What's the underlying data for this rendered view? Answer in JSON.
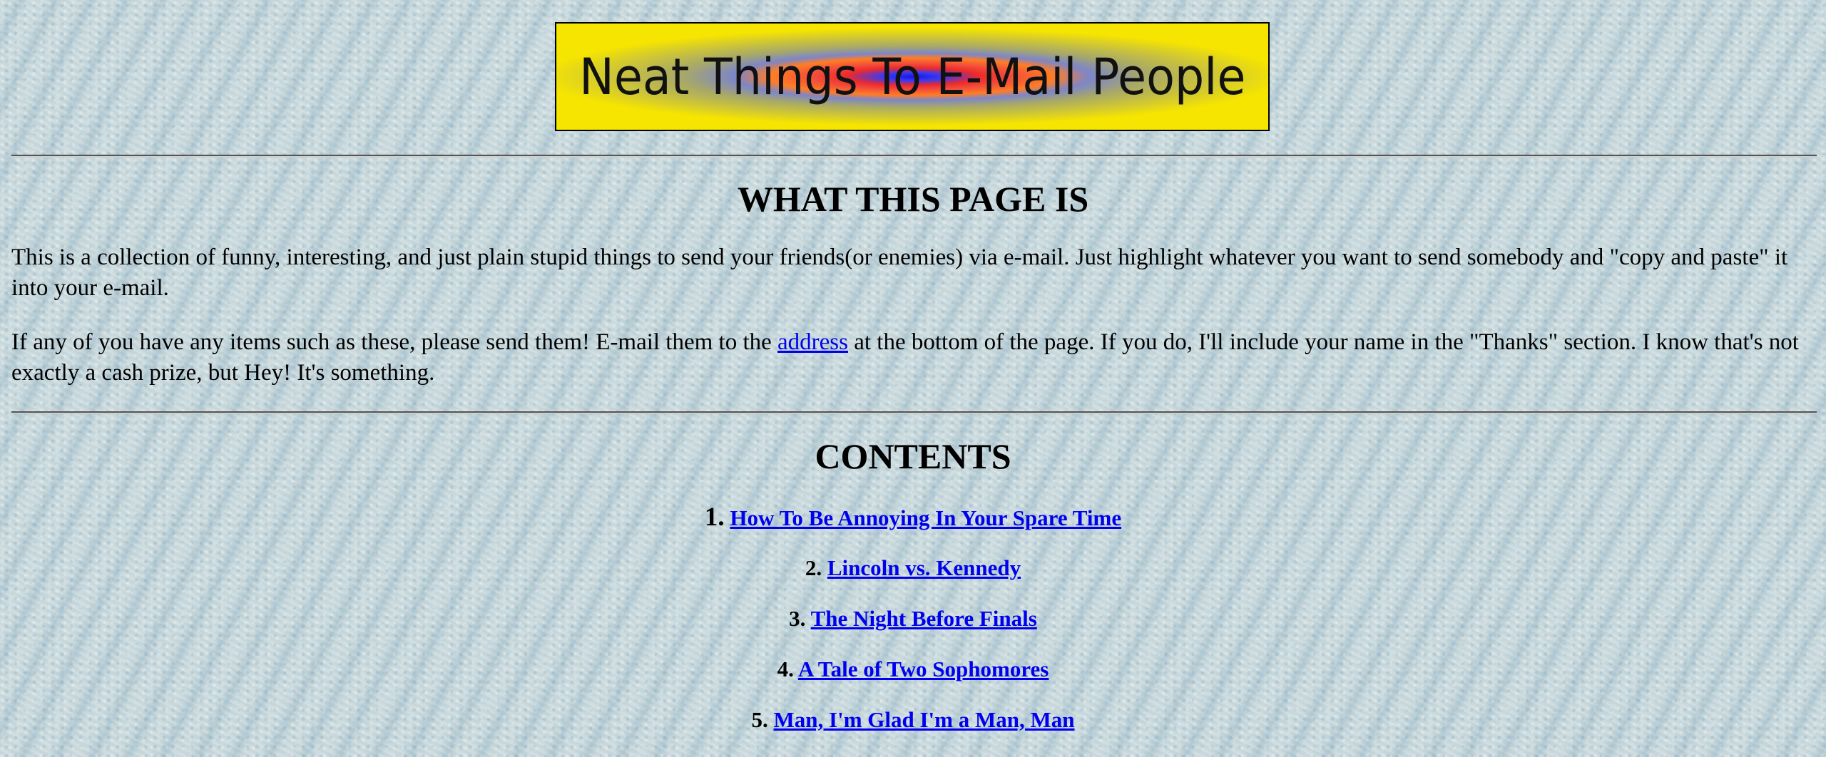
{
  "banner": {
    "text": "Neat Things To E-Mail People"
  },
  "intro": {
    "heading": "WHAT THIS PAGE IS",
    "paragraph1": "This is a collection of funny, interesting, and just plain stupid things to send your friends(or enemies) via e-mail. Just highlight whatever you want to send somebody and \"copy and paste\" it into your e-mail.",
    "paragraph2_before": "If any of you have any items such as these, please send them! E-mail them to the ",
    "paragraph2_link": "address",
    "paragraph2_after": " at the bottom of the page. If you do, I'll include your name in the \"Thanks\" section. I know that's not exactly a cash prize, but Hey! It's something."
  },
  "contents": {
    "heading": "CONTENTS",
    "items": [
      {
        "number": "1.",
        "label": "How To Be Annoying In Your Spare Time"
      },
      {
        "number": "2.",
        "label": "Lincoln vs. Kennedy"
      },
      {
        "number": "3.",
        "label": "The Night Before Finals"
      },
      {
        "number": "4.",
        "label": "A Tale of Two Sophomores"
      },
      {
        "number": "5.",
        "label": "Man, I'm Glad I'm a Man, Man"
      }
    ]
  },
  "colors": {
    "link": "#0000ee",
    "text": "#000000",
    "background": "#c9d9dc",
    "banner_outer": "#f6e500",
    "banner_center": "#1616e8"
  }
}
